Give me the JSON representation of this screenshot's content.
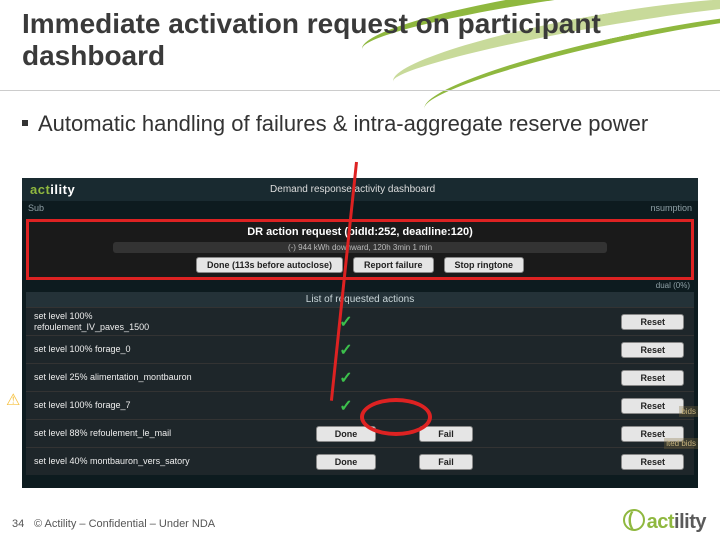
{
  "slide": {
    "title": "Immediate activation request on participant dashboard",
    "bullet": "Automatic handling of failures & intra-aggregate reserve power"
  },
  "dashboard": {
    "brand": "actility",
    "title": "Demand response activity dashboard",
    "action_request": {
      "title": "DR action request (bidId:252, deadline:120)",
      "sub": "(-) 944 kWh downward, 120h 3min 1 min",
      "buttons": {
        "done": "Done (113s before autoclose)",
        "report": "Report failure",
        "stop": "Stop ringtone"
      }
    },
    "left_header": "Sub",
    "right_header": "nsumption",
    "right_sub": "dual (0%)",
    "list_header": "List of requested actions",
    "rows": [
      {
        "label_a": "set level 100%",
        "label_b": "refoulement_IV_paves_1500",
        "status": "check",
        "done": "",
        "fail": "",
        "reset": "Reset"
      },
      {
        "label_a": "set level 100% forage_0",
        "label_b": "",
        "status": "check",
        "done": "",
        "fail": "",
        "reset": "Reset"
      },
      {
        "label_a": "set level 25% alimentation_montbauron",
        "label_b": "",
        "status": "check",
        "done": "",
        "fail": "",
        "reset": "Reset"
      },
      {
        "label_a": "set level 100% forage_7",
        "label_b": "",
        "status": "check",
        "done": "",
        "fail": "",
        "reset": "Reset"
      },
      {
        "label_a": "set level 88% refoulement_le_mail",
        "label_b": "",
        "status": "",
        "done": "Done",
        "fail": "Fail",
        "reset": "Reset"
      },
      {
        "label_a": "set level 40% montbauron_vers_satory",
        "label_b": "",
        "status": "",
        "done": "Done",
        "fail": "Fail",
        "reset": "Reset"
      }
    ],
    "side_hints": {
      "a": "bids",
      "b": "ited bids"
    }
  },
  "footer": {
    "page": "34",
    "text": "© Actility – Confidential – Under NDA",
    "logo": "actility"
  }
}
